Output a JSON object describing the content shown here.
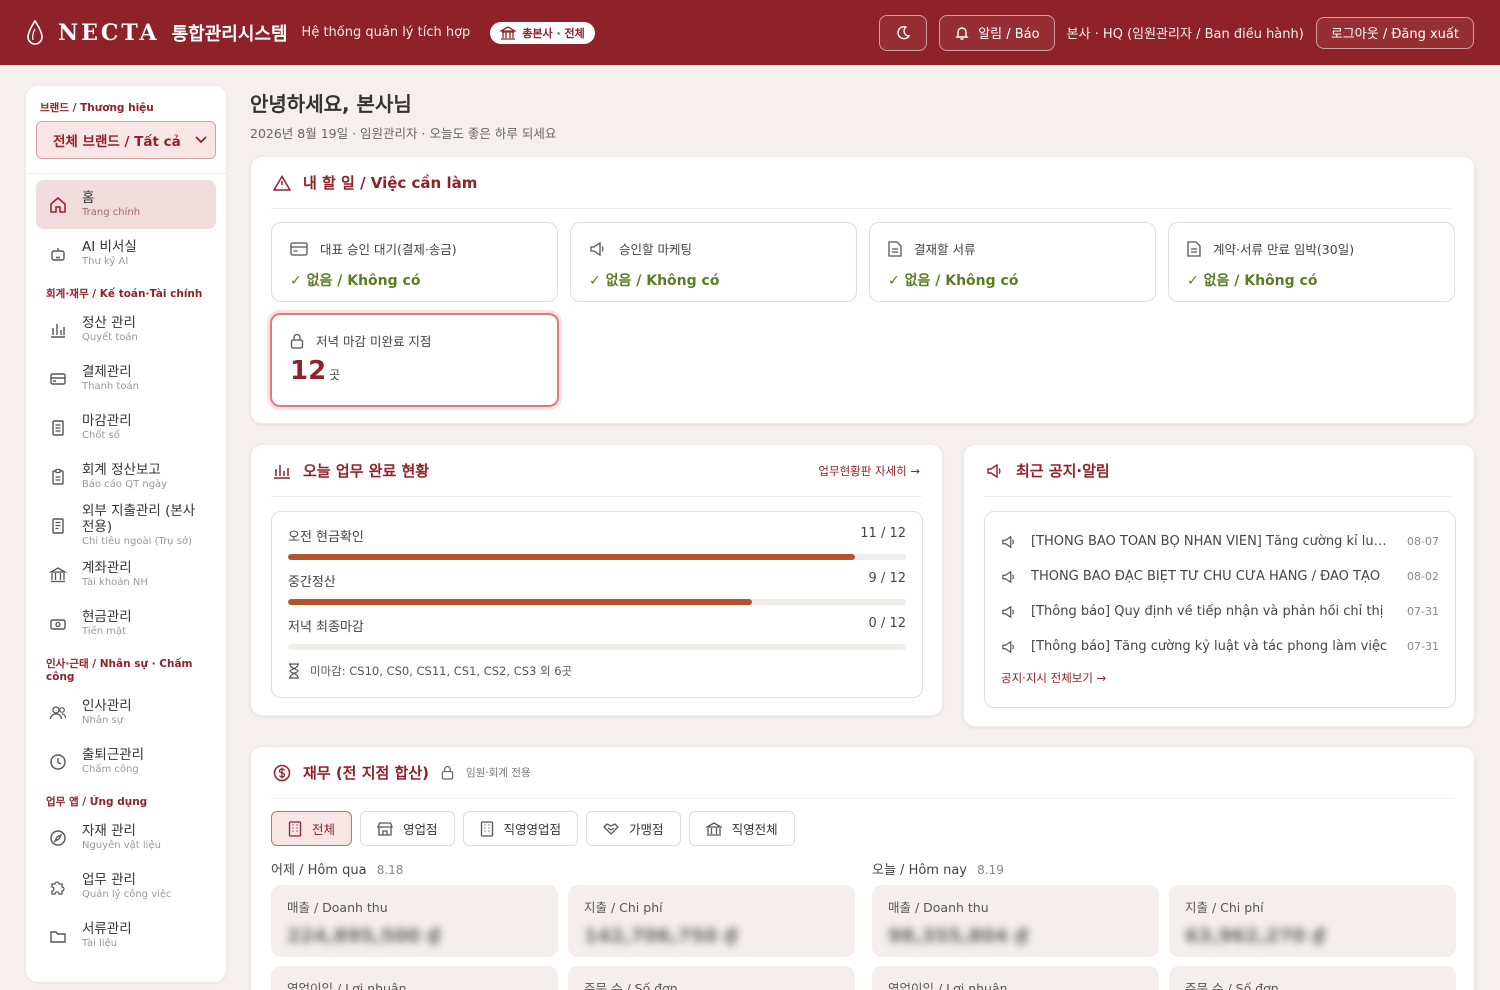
{
  "header": {
    "logo": "NECTA",
    "logo_kr": "통합관리시스템",
    "subtitle": "Hệ thống quản lý tích hợp",
    "badge": "총본사 · 전체",
    "alert_label": "알림 / Báo",
    "user": "본사 · HQ (임원관리자 / Ban điều hành)",
    "logout": "로그아웃 / Đăng xuất"
  },
  "sidebar": {
    "brand_label": "브랜드 / Thương hiệu",
    "brand_value": "전체 브랜드 / Tất cả",
    "items_top": [
      {
        "title": "홈",
        "sub": "Trang chính",
        "icon": "home-icon",
        "active": true
      },
      {
        "title": "AI 비서실",
        "sub": "Thư ký AI",
        "icon": "robot-icon"
      }
    ],
    "section_finance": "회계·재무 / Kế toán·Tài chính",
    "items_finance": [
      {
        "title": "정산 관리",
        "sub": "Quyết toán",
        "icon": "bar-chart-icon"
      },
      {
        "title": "결제관리",
        "sub": "Thanh toán",
        "icon": "card-icon"
      },
      {
        "title": "마감관리",
        "sub": "Chốt sổ",
        "icon": "doc-icon"
      },
      {
        "title": "회계 정산보고",
        "sub": "Báo cáo QT ngày",
        "icon": "clipboard-icon"
      },
      {
        "title": "외부 지출관리 (본사전용)",
        "sub": "Chi tiêu ngoài (Trụ sở)",
        "icon": "receipt-icon"
      },
      {
        "title": "계좌관리",
        "sub": "Tài khoản NH",
        "icon": "bank-icon"
      },
      {
        "title": "현금관리",
        "sub": "Tiền mặt",
        "icon": "cash-icon"
      }
    ],
    "section_hr": "인사·근태 / Nhân sự · Chấm công",
    "items_hr": [
      {
        "title": "인사관리",
        "sub": "Nhân sự",
        "icon": "users-icon"
      },
      {
        "title": "출퇴근관리",
        "sub": "Chấm công",
        "icon": "clock-icon"
      }
    ],
    "section_apps": "업무 앱 / Ứng dụng",
    "items_apps": [
      {
        "title": "자재 관리",
        "sub": "Nguyên vật liệu",
        "icon": "compass-icon"
      },
      {
        "title": "업무 관리",
        "sub": "Quản lý công việc",
        "icon": "puzzle-icon"
      },
      {
        "title": "서류관리",
        "sub": "Tài liệu",
        "icon": "folder-icon"
      }
    ]
  },
  "main": {
    "greeting": "안녕하세요, 본사님",
    "greeting_sub": "2026년 8월 19일 · 임원관리자 · 오늘도 좋은 하루 되세요",
    "todo": {
      "title": "내 할 일 / Việc cần làm",
      "items": [
        {
          "label": "대표 승인 대기(결제·송금)",
          "status": "✓ 없음 / Không có",
          "icon": "card-icon"
        },
        {
          "label": "승인할 마케팅",
          "status": "✓ 없음 / Không có",
          "icon": "megaphone-icon"
        },
        {
          "label": "결재할 서류",
          "status": "✓ 없음 / Không có",
          "icon": "doc-icon"
        },
        {
          "label": "계약·서류 만료 임박(30일)",
          "status": "✓ 없음 / Không có",
          "icon": "doc-icon"
        }
      ],
      "alert": {
        "label": "저녁 마감 미완료 지점",
        "value": "12",
        "unit": "곳"
      }
    },
    "progress": {
      "title": "오늘 업무 완료 현황",
      "link": "업무현황판 자세히 →",
      "rows": [
        {
          "label": "오전 현금확인",
          "count": "11 / 12",
          "ratio": 0.917
        },
        {
          "label": "중간정산",
          "count": "9 / 12",
          "ratio": 0.75
        },
        {
          "label": "저녁 최종마감",
          "count": "0 / 12",
          "ratio": 0
        }
      ],
      "unfinished": "미마감: CS10, CS0, CS11, CS1, CS2, CS3 외 6곳"
    },
    "notices": {
      "title": "최근 공지·알림",
      "items": [
        {
          "text": "[THÔNG BÁO TOÀN BỘ NHÂN VIÊN] Tăng cường kỉ luật và tác phong",
          "date": "08-07"
        },
        {
          "text": "THÔNG BÁO ĐẶC BIỆT TỪ CHỦ CỬA HÀNG / ĐÀO TẠO",
          "date": "08-02"
        },
        {
          "text": "[Thông báo] Quy định về tiếp nhận và phản hồi chỉ thị",
          "date": "07-31"
        },
        {
          "text": "[Thông báo] Tăng cường kỷ luật và tác phong làm việc",
          "date": "07-31"
        }
      ],
      "link": "공지·지시 전체보기 →"
    },
    "finance": {
      "title": "재무 (전 지점 합산)",
      "lock_note": "임원·회계 전용",
      "tabs": [
        "전체",
        "영업점",
        "직영영업점",
        "가맹점",
        "직영전체"
      ],
      "yesterday": {
        "label": "어제 / Hôm qua",
        "date": "8.18"
      },
      "today": {
        "label": "오늘 / Hôm nay",
        "date": "8.19"
      },
      "metrics": [
        {
          "label": "매출 / Doanh thu",
          "value": "224,895,500 ₫"
        },
        {
          "label": "지출 / Chi phí",
          "value": "142,706,750 ₫"
        },
        {
          "label": "매출 / Doanh thu",
          "value": "98,355,804 ₫"
        },
        {
          "label": "지출 / Chi phí",
          "value": "63,962,270 ₫"
        }
      ],
      "metrics2": [
        {
          "label": "영업이익 / Lợi nhuận"
        },
        {
          "label": "주문 수 / Số đơn"
        },
        {
          "label": "영업이익 / Lợi nhuận"
        },
        {
          "label": "주문 수 / Số đơn"
        }
      ]
    }
  },
  "colors": {
    "brand": "#8f2228",
    "accent": "#b4542c",
    "ok": "#5a7d24"
  }
}
